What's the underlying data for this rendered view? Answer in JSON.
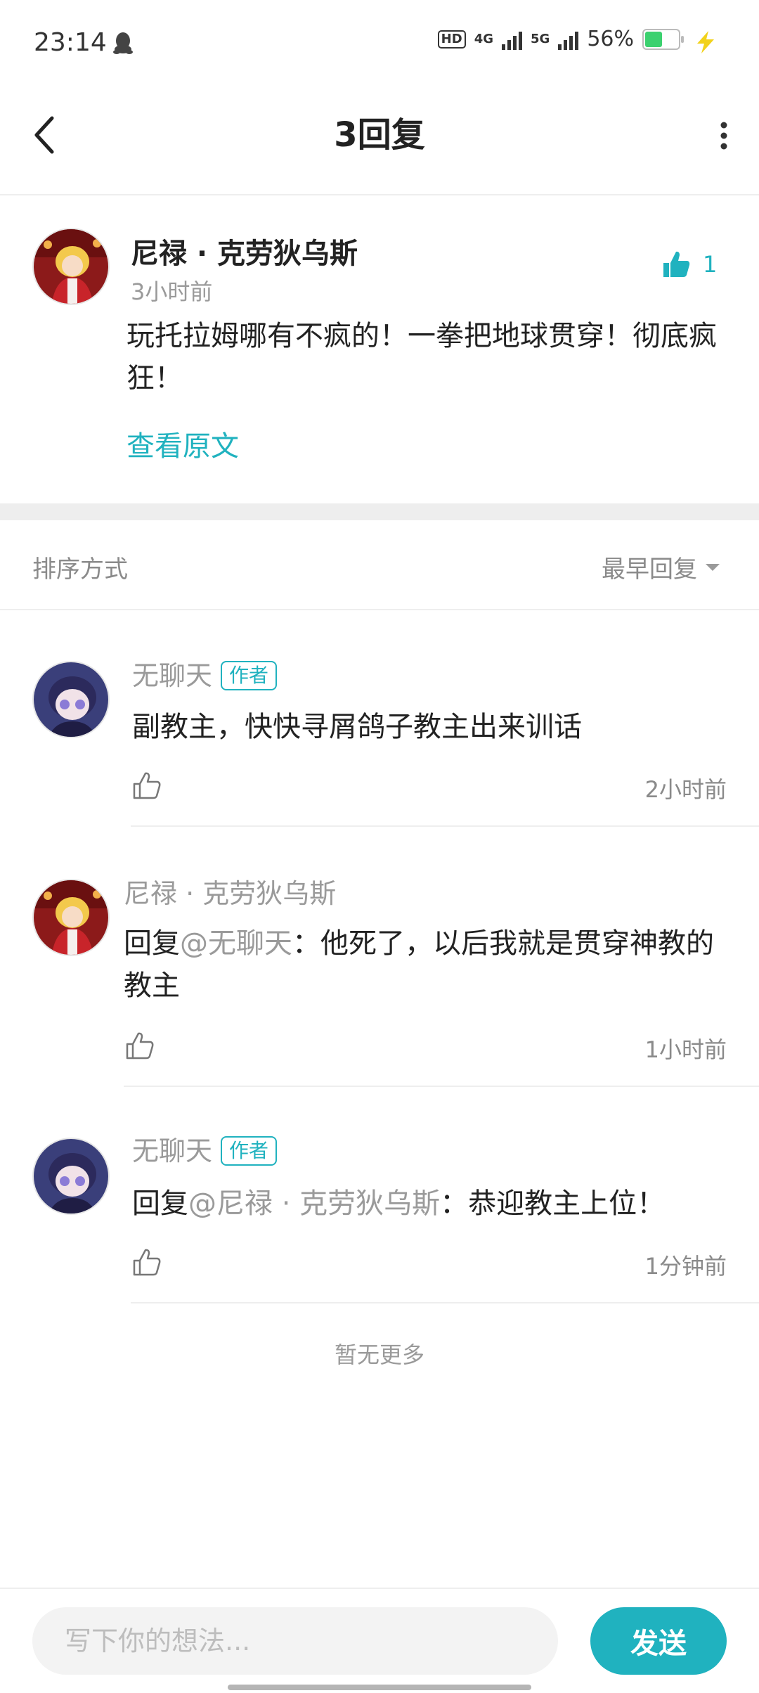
{
  "status_bar": {
    "time": "23:14",
    "hd_label": "HD",
    "net1": "4G",
    "net2": "5G",
    "battery": "56%",
    "battery_level": 0.56
  },
  "header": {
    "title": "3回复"
  },
  "main_post": {
    "author": "尼禄 · 克劳狄乌斯",
    "time": "3小时前",
    "text": "玩托拉姆哪有不疯的！一拳把地球贯穿！彻底疯狂！",
    "view_original": "查看原文",
    "like_count": "1"
  },
  "sort": {
    "label": "排序方式",
    "value": "最早回复"
  },
  "replies": [
    {
      "author": "无聊天",
      "badge": "作者",
      "text": "副教主，快快寻屑鸽子教主出来训话",
      "time": "2小时前"
    },
    {
      "author": "尼禄 · 克劳狄乌斯",
      "prefix": "回复",
      "mention": "@无聊天",
      "text": "：他死了，以后我就是贯穿神教的教主",
      "time": "1小时前"
    },
    {
      "author": "无聊天",
      "badge": "作者",
      "prefix": "回复",
      "mention": "@尼禄 · 克劳狄乌斯",
      "text": "：恭迎教主上位！",
      "time": "1分钟前"
    }
  ],
  "footer_text": "暂无更多",
  "input": {
    "placeholder": "写下你的想法...",
    "send_label": "发送"
  },
  "colors": {
    "accent": "#20b2bf",
    "muted": "#9a9a9a"
  }
}
